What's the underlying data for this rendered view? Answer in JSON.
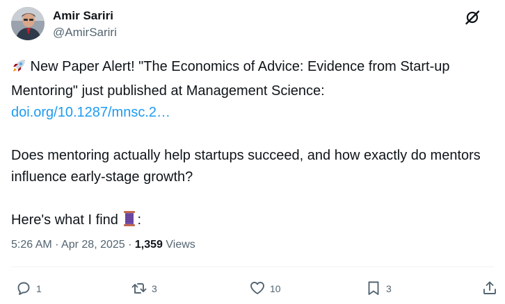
{
  "author": {
    "name": "Amir Sariri",
    "handle": "@AmirSariri"
  },
  "tweet": {
    "line1_emoji": "rocket-icon",
    "line1_text": " New Paper Alert! \"The Economics of Advice: Evidence from Start-up Mentoring\" just published at Management Science:",
    "link_text": "doi.org/10.1287/mnsc.2…",
    "paragraph2": "Does mentoring actually help startups succeed, and how exactly do mentors influence early-stage growth?",
    "paragraph3_text": "Here's what I find ",
    "paragraph3_emoji": "thread-icon",
    "paragraph3_suffix": ":"
  },
  "meta": {
    "time": "5:26 AM",
    "separator1": " · ",
    "date": "Apr 28, 2025",
    "separator2": " · ",
    "views_count": "1,359",
    "views_label": " Views"
  },
  "actions": {
    "replies": "1",
    "reposts": "3",
    "likes": "10",
    "bookmarks": "3"
  },
  "colors": {
    "link": "#1d9bf0",
    "secondary_text": "#536471",
    "primary_text": "#0f1419"
  }
}
